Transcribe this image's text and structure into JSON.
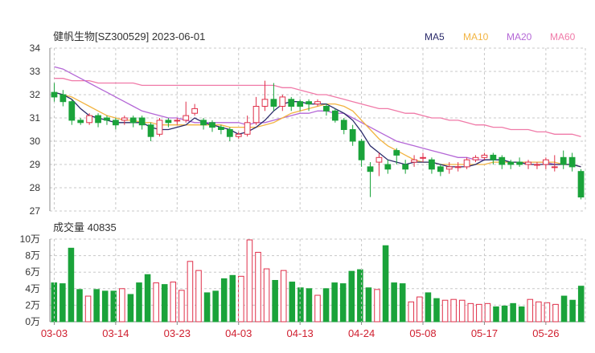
{
  "header": {
    "title": "健帆生物[SZ300529] 2023-06-01",
    "volume_label": "成交量 40835"
  },
  "legend": [
    {
      "name": "MA5",
      "color": "#2a2a6a"
    },
    {
      "name": "MA10",
      "color": "#f2b441"
    },
    {
      "name": "MA20",
      "color": "#b467d6"
    },
    {
      "name": "MA60",
      "color": "#f07aa8"
    }
  ],
  "colors": {
    "up": "#e0304a",
    "down": "#1aa33a",
    "grid": "#c8c8c8",
    "axis_text": "#333333",
    "date_text": "#d02030"
  },
  "chart_data": [
    {
      "type": "candlestick",
      "title": "健帆生物[SZ300529] 2023-06-01",
      "ylim": [
        27,
        34
      ],
      "yticks": [
        27,
        28,
        29,
        30,
        31,
        32,
        33,
        34
      ],
      "dates": [
        "03-03",
        "03-06",
        "03-07",
        "03-08",
        "03-09",
        "03-10",
        "03-13",
        "03-14",
        "03-15",
        "03-16",
        "03-17",
        "03-20",
        "03-21",
        "03-22",
        "03-23",
        "03-24",
        "03-27",
        "03-28",
        "03-29",
        "03-30",
        "03-31",
        "04-03",
        "04-04",
        "04-06",
        "04-07",
        "04-10",
        "04-11",
        "04-12",
        "04-13",
        "04-14",
        "04-17",
        "04-18",
        "04-19",
        "04-20",
        "04-21",
        "04-24",
        "04-25",
        "04-26",
        "04-27",
        "04-28",
        "05-04",
        "05-05",
        "05-08",
        "05-09",
        "05-10",
        "05-11",
        "05-12",
        "05-15",
        "05-16",
        "05-17",
        "05-18",
        "05-19",
        "05-22",
        "05-23",
        "05-24",
        "05-25",
        "05-26",
        "05-29",
        "05-30",
        "05-31",
        "06-01"
      ],
      "x_ticks": [
        "03-03",
        "03-14",
        "03-23",
        "04-03",
        "04-13",
        "04-24",
        "05-08",
        "05-17",
        "05-26"
      ],
      "open": [
        32.1,
        32.0,
        31.7,
        30.9,
        30.8,
        31.1,
        31.0,
        30.9,
        30.9,
        31.0,
        31.0,
        30.7,
        30.3,
        30.9,
        30.9,
        30.9,
        31.2,
        30.9,
        30.8,
        30.6,
        30.5,
        30.2,
        30.3,
        30.8,
        31.5,
        31.8,
        31.5,
        31.8,
        31.7,
        31.7,
        31.6,
        31.5,
        31.3,
        30.9,
        30.5,
        30.0,
        28.9,
        29.1,
        29.0,
        29.6,
        29.0,
        29.1,
        29.3,
        29.2,
        28.9,
        28.8,
        28.9,
        28.9,
        29.2,
        29.3,
        29.4,
        29.3,
        29.1,
        29.1,
        29.0,
        29.0,
        29.0,
        28.9,
        29.3,
        29.3,
        28.7
      ],
      "close": [
        31.9,
        31.7,
        30.9,
        30.8,
        31.1,
        30.8,
        30.9,
        30.7,
        31.0,
        30.8,
        30.7,
        30.2,
        30.9,
        30.8,
        30.9,
        31.1,
        31.4,
        30.7,
        30.6,
        30.5,
        30.2,
        30.3,
        30.8,
        31.5,
        31.8,
        31.5,
        31.9,
        31.5,
        31.5,
        31.6,
        31.7,
        31.3,
        30.9,
        30.5,
        30.0,
        29.2,
        28.7,
        29.3,
        28.8,
        29.4,
        28.8,
        29.2,
        29.3,
        28.8,
        28.7,
        28.9,
        28.9,
        29.2,
        29.3,
        29.4,
        29.2,
        29.0,
        29.0,
        29.0,
        29.1,
        29.0,
        29.2,
        28.9,
        29.0,
        28.9,
        27.6
      ],
      "high": [
        32.5,
        32.2,
        31.8,
        31.0,
        31.2,
        31.2,
        31.1,
        31.0,
        31.1,
        31.1,
        31.1,
        30.8,
        31.0,
        31.0,
        31.0,
        31.7,
        31.6,
        31.0,
        30.9,
        30.7,
        30.6,
        30.4,
        31.1,
        31.9,
        32.6,
        32.5,
        32.0,
        31.9,
        31.8,
        31.8,
        31.8,
        31.6,
        31.4,
        31.0,
        30.7,
        30.1,
        29.1,
        29.5,
        29.2,
        29.7,
        29.2,
        29.4,
        29.5,
        29.3,
        29.0,
        29.1,
        29.1,
        29.3,
        29.4,
        29.5,
        29.5,
        29.4,
        29.2,
        29.3,
        29.2,
        29.1,
        29.3,
        29.4,
        29.6,
        29.5,
        28.8
      ],
      "low": [
        31.7,
        31.5,
        30.7,
        30.7,
        30.7,
        30.6,
        30.7,
        30.5,
        30.7,
        30.6,
        30.5,
        30.0,
        30.2,
        30.6,
        30.7,
        30.8,
        31.1,
        30.5,
        30.4,
        30.3,
        30.0,
        30.1,
        30.2,
        30.7,
        31.3,
        31.3,
        31.3,
        31.3,
        31.3,
        31.3,
        31.5,
        31.1,
        30.8,
        30.3,
        29.8,
        28.9,
        27.6,
        28.5,
        28.6,
        29.0,
        28.6,
        28.9,
        29.1,
        28.6,
        28.5,
        28.6,
        28.7,
        28.8,
        29.1,
        29.2,
        29.0,
        28.8,
        28.8,
        28.9,
        28.8,
        28.8,
        28.8,
        28.7,
        28.8,
        28.7,
        27.5
      ],
      "ma5": [
        32.1,
        32.0,
        31.8,
        31.4,
        31.1,
        31.0,
        30.9,
        30.8,
        30.8,
        30.8,
        30.8,
        30.6,
        30.5,
        30.5,
        30.6,
        30.7,
        31.0,
        30.8,
        30.7,
        30.6,
        30.5,
        30.3,
        30.4,
        30.6,
        30.9,
        31.3,
        31.6,
        31.7,
        31.7,
        31.6,
        31.6,
        31.6,
        31.4,
        31.2,
        30.9,
        30.4,
        29.8,
        29.5,
        29.2,
        29.1,
        29.0,
        29.1,
        29.1,
        29.1,
        29.0,
        28.9,
        28.9,
        28.9,
        29.0,
        29.2,
        29.2,
        29.2,
        29.1,
        29.1,
        29.0,
        29.0,
        29.0,
        29.0,
        29.0,
        29.0,
        28.9
      ],
      "ma10": [
        32.1,
        32.0,
        31.9,
        31.7,
        31.5,
        31.3,
        31.1,
        31.0,
        30.9,
        30.9,
        30.8,
        30.8,
        30.7,
        30.7,
        30.7,
        30.7,
        30.7,
        30.7,
        30.7,
        30.7,
        30.6,
        30.6,
        30.6,
        30.6,
        30.7,
        30.8,
        31.0,
        31.2,
        31.3,
        31.4,
        31.5,
        31.6,
        31.6,
        31.5,
        31.3,
        30.9,
        30.5,
        30.1,
        29.8,
        29.6,
        29.4,
        29.2,
        29.1,
        29.1,
        29.0,
        29.0,
        29.0,
        29.0,
        29.0,
        29.0,
        29.1,
        29.1,
        29.1,
        29.1,
        29.1,
        29.1,
        29.1,
        29.1,
        29.0,
        29.0,
        28.9
      ],
      "ma20": [
        33.2,
        33.1,
        32.9,
        32.7,
        32.5,
        32.3,
        32.1,
        31.9,
        31.7,
        31.5,
        31.3,
        31.2,
        31.1,
        31.0,
        31.0,
        30.9,
        30.8,
        30.8,
        30.8,
        30.8,
        30.8,
        30.8,
        30.7,
        30.8,
        30.8,
        30.9,
        31.0,
        31.1,
        31.2,
        31.2,
        31.3,
        31.3,
        31.2,
        31.2,
        31.0,
        30.8,
        30.6,
        30.4,
        30.2,
        30.0,
        29.9,
        29.8,
        29.7,
        29.6,
        29.5,
        29.4,
        29.3,
        29.3,
        29.2,
        29.2,
        29.2,
        29.2,
        29.1,
        29.1,
        29.1,
        29.1,
        29.1,
        29.0,
        29.0,
        29.0,
        28.9
      ],
      "ma60": [
        32.7,
        32.7,
        32.6,
        32.6,
        32.6,
        32.5,
        32.5,
        32.5,
        32.5,
        32.5,
        32.4,
        32.4,
        32.4,
        32.4,
        32.4,
        32.4,
        32.4,
        32.4,
        32.4,
        32.4,
        32.4,
        32.4,
        32.4,
        32.4,
        32.4,
        32.4,
        32.3,
        32.3,
        32.2,
        32.1,
        32.0,
        32.0,
        31.9,
        31.8,
        31.7,
        31.6,
        31.5,
        31.4,
        31.4,
        31.3,
        31.2,
        31.2,
        31.1,
        31.0,
        31.0,
        30.9,
        30.9,
        30.8,
        30.7,
        30.7,
        30.6,
        30.6,
        30.5,
        30.5,
        30.5,
        30.4,
        30.4,
        30.3,
        30.3,
        30.3,
        30.2
      ]
    },
    {
      "type": "bar",
      "title": "成交量 40835",
      "yticks_labels": [
        "0万",
        "2万",
        "4万",
        "6万",
        "8万",
        "10万"
      ],
      "yticks": [
        0,
        20000,
        40000,
        60000,
        80000,
        100000
      ],
      "ylim": [
        0,
        100000
      ],
      "values": [
        47000,
        46000,
        89000,
        39000,
        31000,
        39000,
        37000,
        37000,
        40000,
        33000,
        47000,
        57000,
        47000,
        45000,
        48000,
        38000,
        73000,
        62000,
        35000,
        37000,
        52000,
        56000,
        55000,
        99000,
        84000,
        64000,
        50000,
        62000,
        48000,
        41000,
        40000,
        32000,
        40000,
        47000,
        46000,
        61000,
        63000,
        41000,
        39000,
        92000,
        47000,
        46000,
        24000,
        30000,
        35000,
        28000,
        26000,
        27000,
        26000,
        22000,
        21000,
        22000,
        18000,
        19000,
        22000,
        18000,
        27000,
        24000,
        23000,
        21000,
        31000,
        26000,
        43000
      ]
    }
  ]
}
